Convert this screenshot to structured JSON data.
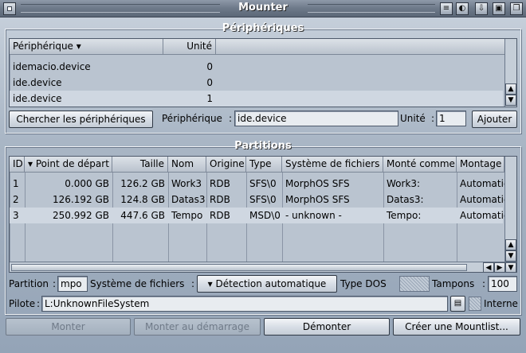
{
  "window": {
    "title": "Mounter",
    "buttons": [
      "iconify-icon",
      "snapshot-icon",
      "jump-icon",
      "zoom-icon",
      "depth-icon"
    ]
  },
  "devices": {
    "title": "Périphériques",
    "columns": [
      "Périphérique",
      "Unité"
    ],
    "rows": [
      {
        "device": "idemacio.device",
        "unit": "0"
      },
      {
        "device": "ide.device",
        "unit": "0"
      },
      {
        "device": "ide.device",
        "unit": "1"
      }
    ],
    "search_button": "Chercher les périphériques",
    "device_label": "Périphérique",
    "device_value": "ide.device",
    "unit_label": "Unité",
    "unit_value": "1",
    "add_button": "Ajouter"
  },
  "partitions": {
    "title": "Partitions",
    "columns": [
      "ID",
      "Point de départ",
      "Taille",
      "Nom",
      "Origine",
      "Type",
      "Système de fichiers",
      "Monté comme",
      "Montage"
    ],
    "rows": [
      {
        "id": "1",
        "start": "0.000 GB",
        "size": "126.2 GB",
        "name": "Work3",
        "origin": "RDB",
        "type": "SFS\\0",
        "fs": "MorphOS SFS",
        "mounted": "Work3:",
        "mount": "Automatic"
      },
      {
        "id": "2",
        "start": "126.192 GB",
        "size": "124.8 GB",
        "name": "Datas3",
        "origin": "RDB",
        "type": "SFS\\0",
        "fs": "MorphOS SFS",
        "mounted": "Datas3:",
        "mount": "Automatic"
      },
      {
        "id": "3",
        "start": "250.992 GB",
        "size": "447.6 GB",
        "name": "Tempo",
        "origin": "RDB",
        "type": "MSD\\0",
        "fs": "- unknown -",
        "mounted": "Tempo:",
        "mount": "Automatic"
      }
    ],
    "partition_label": "Partition",
    "partition_value": "mpo",
    "fs_label": "Système de fichiers",
    "fs_value": "Détection automatique",
    "dostype_label": "Type DOS",
    "buffers_label": "Tampons",
    "buffers_value": "100",
    "driver_label": "Pilote",
    "driver_value": "L:UnknownFileSystem",
    "internal_label": "Interne"
  },
  "actions": {
    "mount": "Monter",
    "mount_boot": "Monter au démarrage",
    "unmount": "Démonter",
    "create_mountlist": "Créer une Mountlist..."
  }
}
